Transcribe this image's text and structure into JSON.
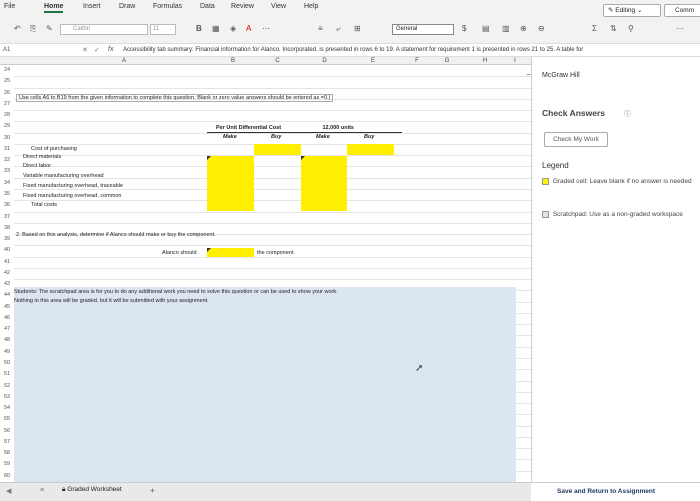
{
  "ribbon": {
    "tabs": [
      "File",
      "Home",
      "Insert",
      "Draw",
      "Formulas",
      "Data",
      "Review",
      "View",
      "Help"
    ],
    "editing_label": "Editing",
    "comments_label": "Comm"
  },
  "toolbar": {
    "font_name": "Calibri",
    "font_size": "11",
    "number_format": "General"
  },
  "formula_bar": {
    "name_box": "A1",
    "formula": "Accessibility tab summary: Financial information for Alanco, Incorporated, is presented in rows 6 to 19. A statement for requirement 1 is presented in rows 21 to 25. A table for"
  },
  "grid": {
    "columns": [
      "A",
      "B",
      "C",
      "D",
      "E",
      "F",
      "G",
      "H",
      "I"
    ],
    "rows": [
      "24",
      "25",
      "26",
      "27",
      "28",
      "29",
      "30",
      "31",
      "32",
      "33",
      "34",
      "35",
      "36",
      "37",
      "38",
      "39",
      "40",
      "41",
      "42",
      "43",
      "44",
      "45",
      "46",
      "47",
      "48",
      "49",
      "50",
      "51",
      "52",
      "53",
      "54",
      "55",
      "56",
      "57",
      "58",
      "59",
      "60"
    ],
    "instruction": "Use cells A6 to B19 from the given information to complete this question. Blank or zero value answers should be entered as =0.)",
    "header_per_unit": "Per Unit Differential Cost",
    "header_units": "12,000 units",
    "header_make": "Make",
    "header_buy": "Buy",
    "cost_rows": [
      "Cost of purchasing",
      "Direct materials",
      "Direct labor",
      "Variable manufacturing overhead",
      "Fixed manufacturing overhead, traceable",
      "Fixed manufacturing overhead, common",
      "Total costs"
    ],
    "question2": "2. Based on this analysis, determine if Alanco should make or buy the component.",
    "alanco_should": "Alanco should",
    "the_component": "the component.",
    "scratch_line1": "Students: The scratchpad area is for you to do any additional work you need to solve this question or can be used to show your work.",
    "scratch_line2": "Nothing in this area will be graded, but it will be submitted with your assignment."
  },
  "panel": {
    "publisher": "McGraw Hill",
    "check_answers": "Check Answers",
    "check_my_work": "Check My Work",
    "legend_title": "Legend",
    "legend_graded": "Graded cell: Leave blank if no answer is needed",
    "legend_scratch": "Scratchpad: Use as a non-graded workspace",
    "save_return": "Save and Return to Assignment"
  },
  "status": {
    "sheet_tab": "Graded Worksheet",
    "add_sheet": "+"
  },
  "colors": {
    "graded_yellow": "#ffef00",
    "scratch_blue": "#dce6f1",
    "excel_green": "#217346"
  }
}
